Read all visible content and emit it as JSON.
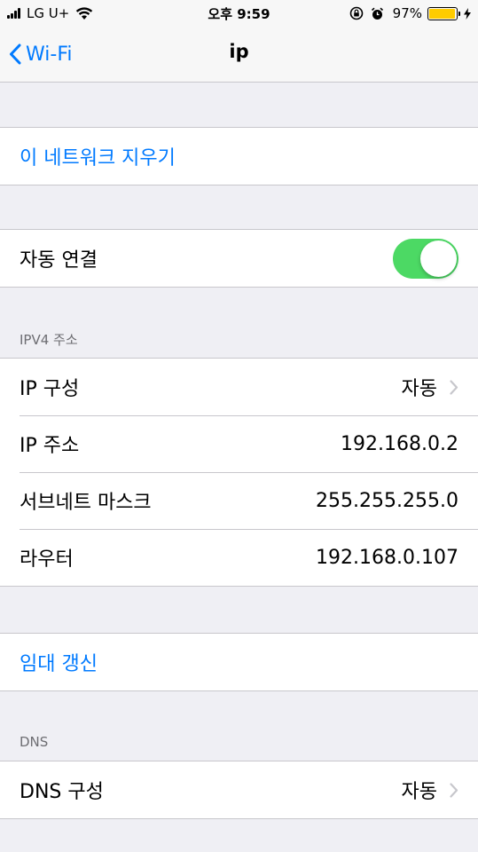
{
  "status_bar": {
    "carrier": "LG U+",
    "time": "오후 9:59",
    "battery_percent": "97%",
    "battery_level": 0.97,
    "icons": [
      "signal-icon",
      "wifi-icon",
      "orientation-lock-icon",
      "alarm-icon",
      "battery-icon",
      "charging-icon"
    ]
  },
  "nav": {
    "back_label": "Wi-Fi",
    "title": "ip"
  },
  "forget": {
    "label": "이 네트워크 지우기"
  },
  "auto_join": {
    "label": "자동 연결",
    "enabled": true
  },
  "ipv4": {
    "header": "IPV4 주소",
    "rows": [
      {
        "label": "IP 구성",
        "value": "자동"
      },
      {
        "label": "IP 주소",
        "value": "192.168.0.2"
      },
      {
        "label": "서브네트 마스크",
        "value": "255.255.255.0"
      },
      {
        "label": "라우터",
        "value": "192.168.0.107"
      }
    ]
  },
  "renew": {
    "label": "임대 갱신"
  },
  "dns": {
    "header": "DNS",
    "row": {
      "label": "DNS 구성",
      "value": "자동"
    }
  },
  "colors": {
    "accent": "#007aff",
    "toggle_on": "#4cd964",
    "battery": "#ffcc00",
    "background": "#efeff4"
  }
}
